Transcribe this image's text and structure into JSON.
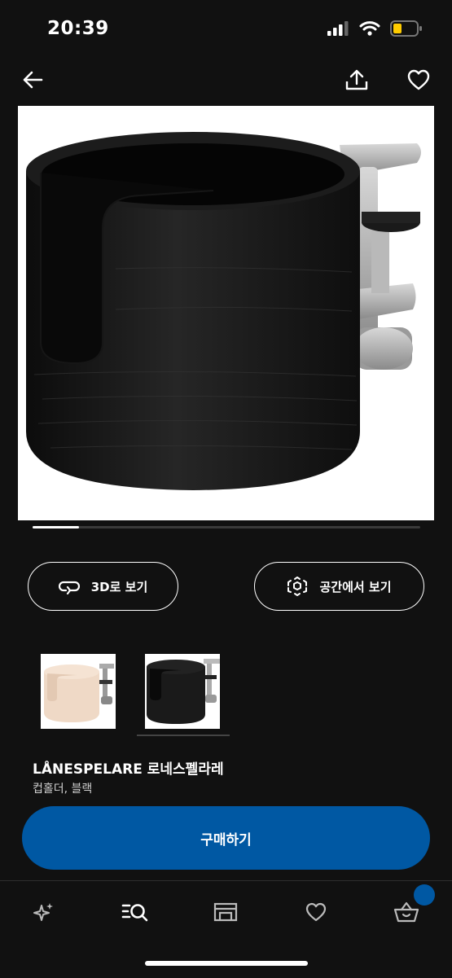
{
  "status": {
    "time": "20:39"
  },
  "actions": {
    "view_3d": "3D로 보기",
    "view_in_space": "공간에서 보기"
  },
  "gallery": {
    "progress": 0.12
  },
  "product": {
    "name": "LÅNESPELARE 로네스펠라레",
    "description": "컵홀더, 블랙"
  },
  "buy": {
    "label": "구매하기"
  },
  "tabs": [
    "sparkle-icon",
    "search-list-icon",
    "store-icon",
    "heart-icon",
    "basket-icon"
  ],
  "colors": {
    "accent": "#0058a3",
    "background": "#111111",
    "battery": "#ffcc00"
  }
}
